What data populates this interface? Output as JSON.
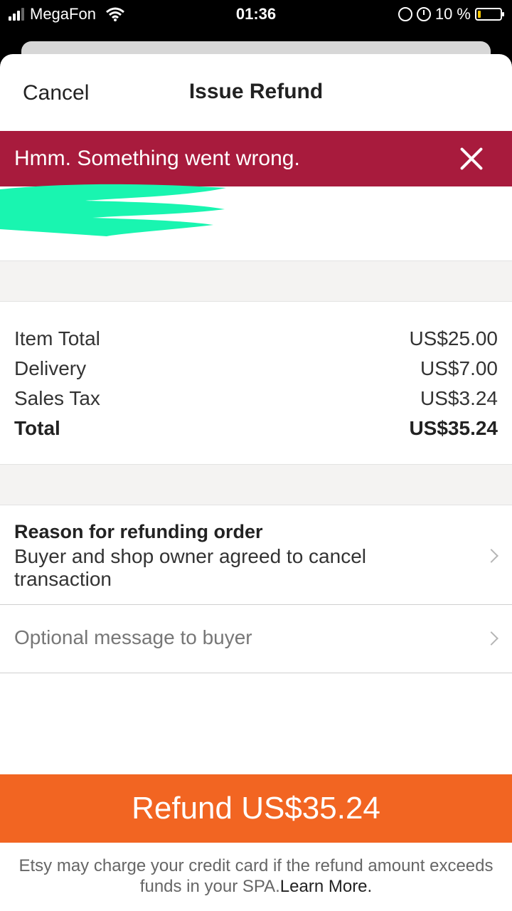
{
  "status_bar": {
    "carrier": "MegaFon",
    "time": "01:36",
    "battery": "10 %"
  },
  "nav": {
    "cancel_label": "Cancel",
    "title": "Issue Refund"
  },
  "error": {
    "message": "Hmm. Something went wrong."
  },
  "summary": {
    "rows": [
      {
        "label": "Item Total",
        "value": "US$25.00"
      },
      {
        "label": "Delivery",
        "value": "US$7.00"
      },
      {
        "label": "Sales Tax",
        "value": "US$3.24"
      },
      {
        "label": "Total",
        "value": "US$35.24"
      }
    ]
  },
  "reason": {
    "title": "Reason for refunding order",
    "value": "Buyer and shop owner agreed to cancel transaction"
  },
  "message": {
    "placeholder": "Optional message to buyer"
  },
  "refund_button": {
    "label": "Refund US$35.24"
  },
  "disclaimer": {
    "text": "Etsy may charge your credit card if the refund amount exceeds funds in your SPA.",
    "link": "Learn More."
  },
  "colors": {
    "error_banner": "#a81b3d",
    "refund_button": "#f26522",
    "redaction": "#19f5b0"
  }
}
